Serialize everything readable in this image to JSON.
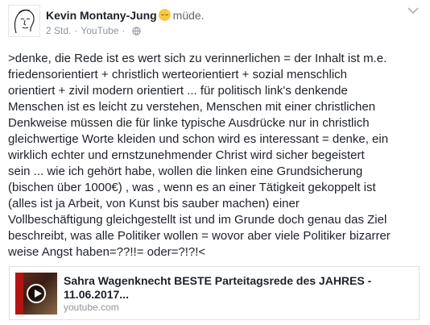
{
  "post": {
    "author": "Kevin Montany-Jung",
    "feeling_icon": "sleepy-face-emoji",
    "feeling": "müde.",
    "time": "2 Std.",
    "separator": "·",
    "source": "YouTube",
    "privacy_icon": "globe-icon",
    "text": ">denke, die Rede ist es wert sich zu verinnerlichen = der Inhalt ist m.e.\nfriedensorientiert + christlich werteorientiert + sozial menschlich\norientiert + zivil modern orientiert ... für politisch link's denkende\nMenschen ist es leicht zu verstehen, Menschen mit einer christlichen\nDenkweise müssen die für linke typische Ausdrücke nur in christlich\ngleichwertige Worte kleiden  und schon wird es interessant = denke, ein\nwirklich  echter und ernstzunehmender Christ wird  sicher begeistert\nsein  ... wie ich gehört habe,  wollen die linken eine Grundsicherung\n(bischen über 1000€) , was , wenn es an einer Tätigkeit gekoppelt ist\n(alles ist ja Arbeit, von Kunst bis sauber machen)  einer\nVollbeschäftigung gleichgestellt ist und im Grunde doch genau das Ziel\nbeschreibt, was alle Politiker wollen = wovor aber viele Politiker bizarrer\nweise Angst haben=??!!= oder=?!?!<"
  },
  "link_preview": {
    "title": "Sahra Wagenknecht BESTE Parteitagsrede des JAHRES - 11.06.2017...",
    "domain": "youtube.com",
    "thumbnail_icon": "play-video-icon"
  },
  "colors": {
    "text": "#1d2129",
    "meta": "#90949c",
    "border": "#dddfe2"
  }
}
